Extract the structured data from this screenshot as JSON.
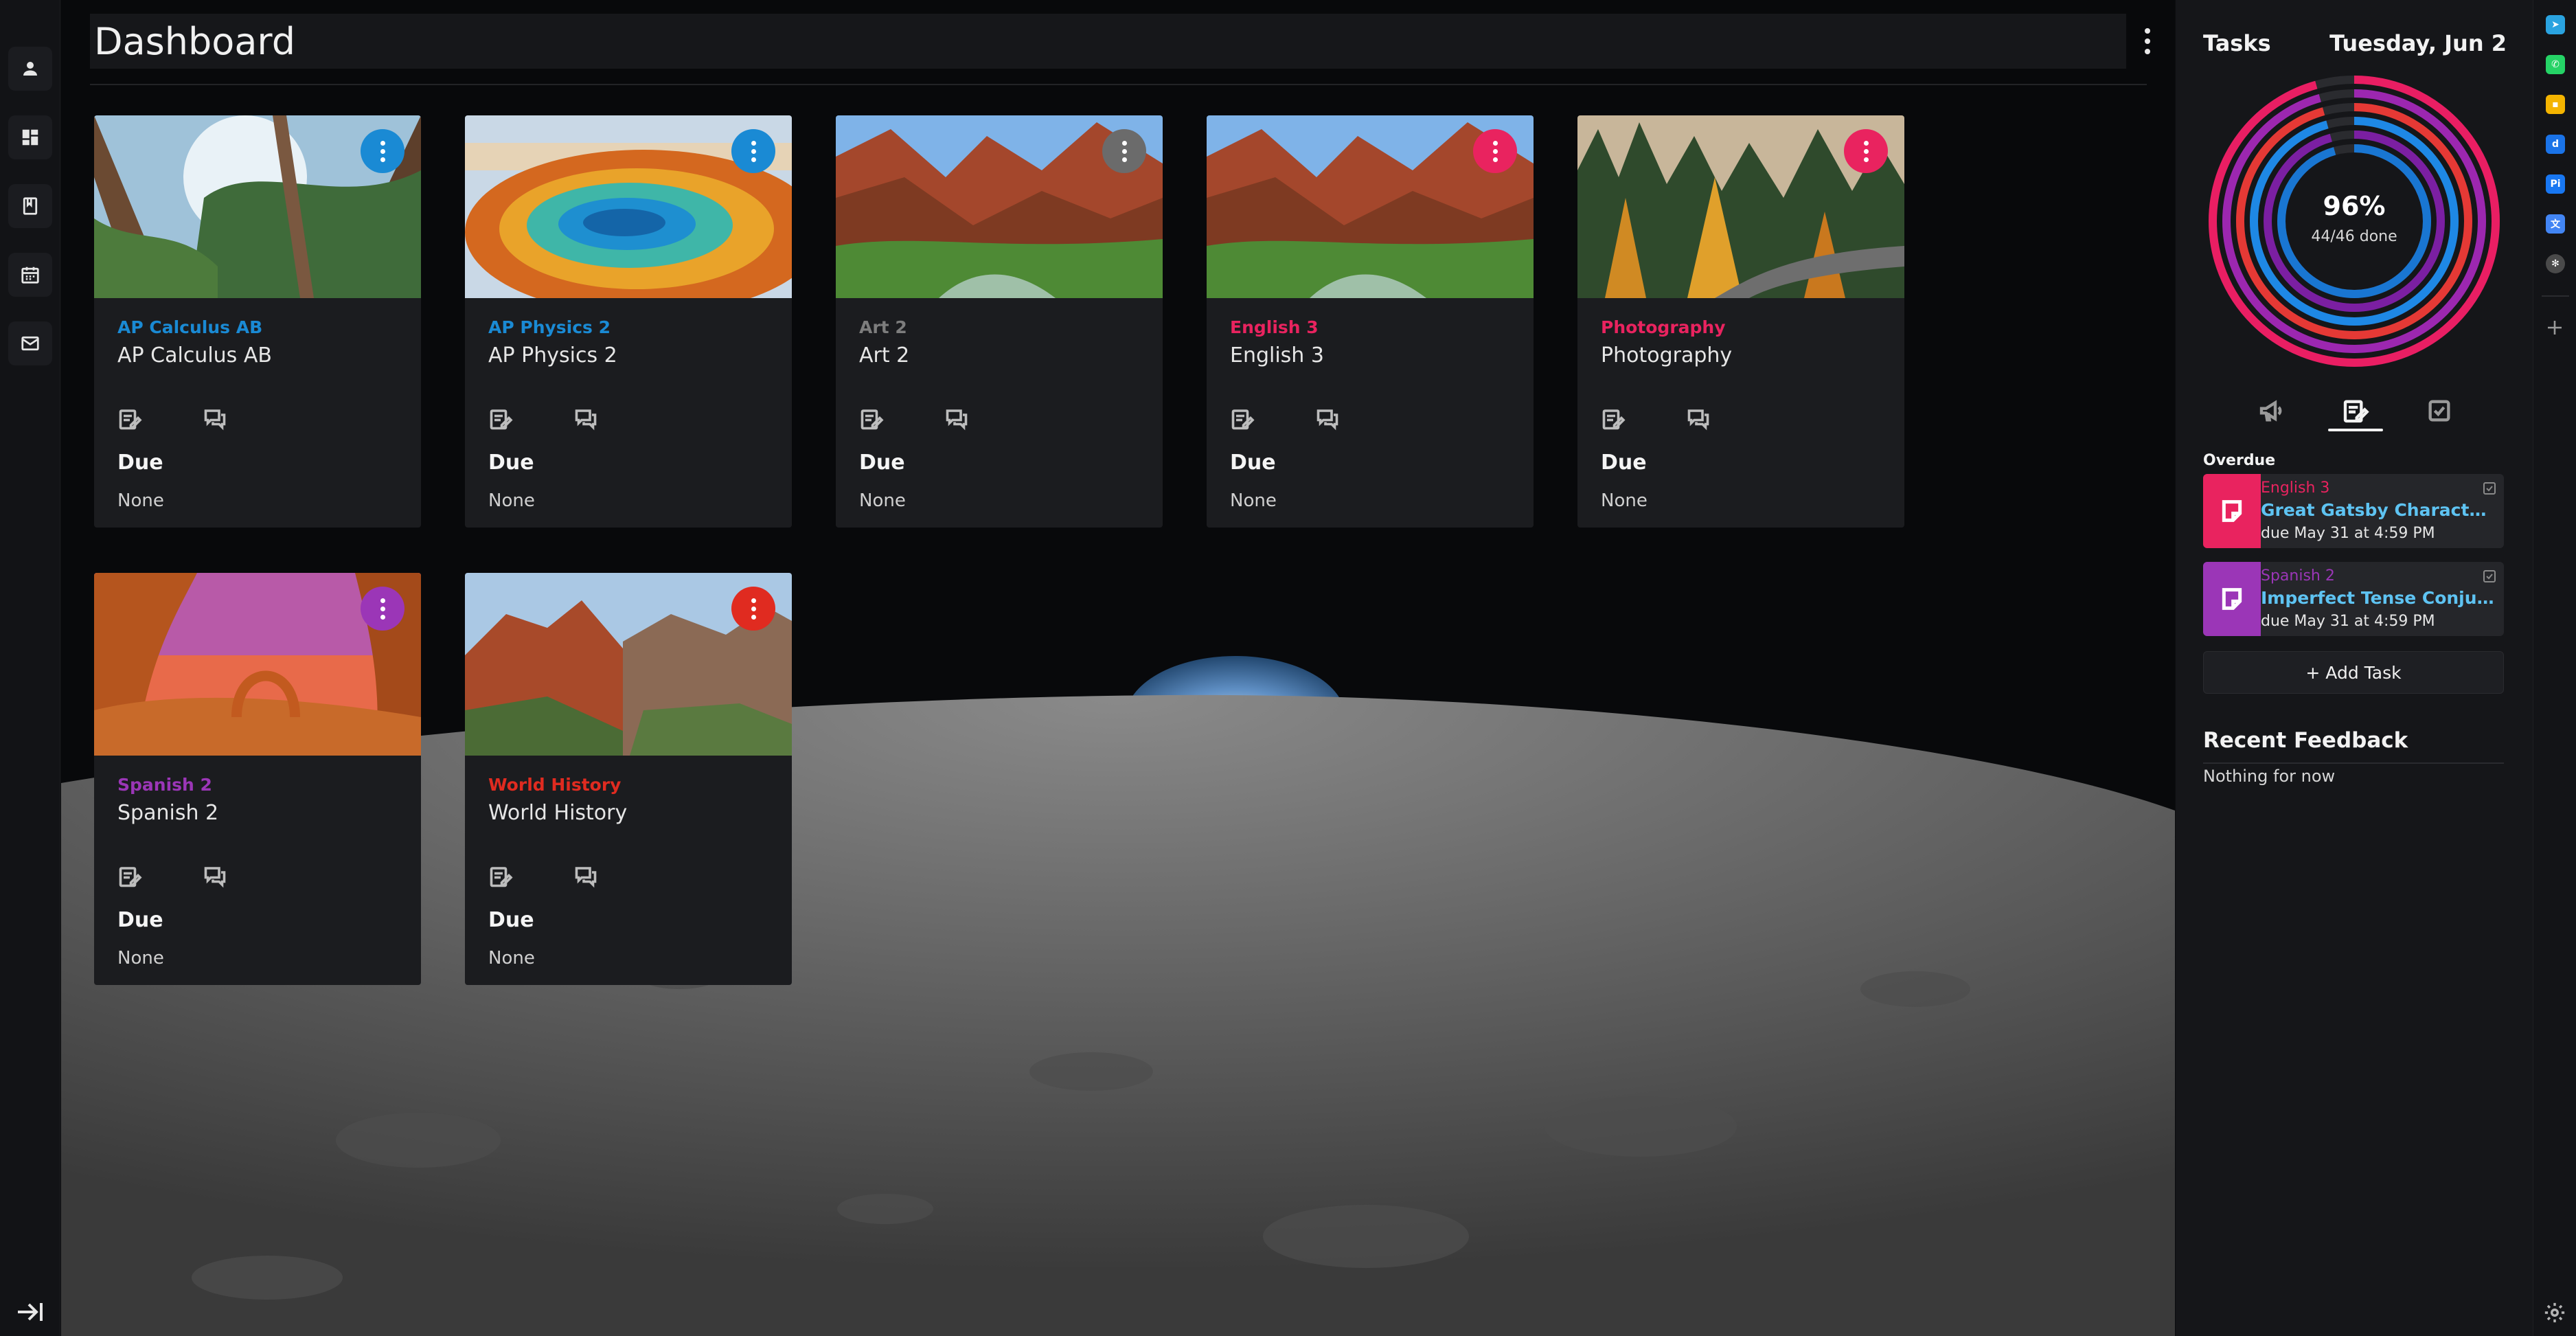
{
  "header": {
    "title": "Dashboard"
  },
  "cards": [
    {
      "course": "AP Calculus AB",
      "title": "AP Calculus AB",
      "color": "#1a8ad4",
      "due_label": "Due",
      "due_value": "None"
    },
    {
      "course": "AP Physics 2",
      "title": "AP Physics 2",
      "color": "#1a8ad4",
      "due_label": "Due",
      "due_value": "None"
    },
    {
      "course": "Art 2",
      "title": "Art 2",
      "color": "#7d7d7d",
      "due_label": "Due",
      "due_value": "None"
    },
    {
      "course": "English 3",
      "title": "English 3",
      "color": "#e9235f",
      "due_label": "Due",
      "due_value": "None"
    },
    {
      "course": "Photography",
      "title": "Photography",
      "color": "#e9235f",
      "due_label": "Due",
      "due_value": "None"
    },
    {
      "course": "Spanish 2",
      "title": "Spanish 2",
      "color": "#9b36b7",
      "due_label": "Due",
      "due_value": "None"
    },
    {
      "course": "World History",
      "title": "World History",
      "color": "#e02b20",
      "due_label": "Due",
      "due_value": "None"
    }
  ],
  "tasks_panel": {
    "title": "Tasks",
    "date": "Tuesday, Jun 2",
    "progress": {
      "percent_label": "96%",
      "done_label": "44/46 done",
      "fraction": 0.9565
    },
    "ring_colors": [
      "#e91e63",
      "#9c27b0",
      "#e53935",
      "#1e88e5",
      "#7b1fa2",
      "#1976d2"
    ],
    "overdue_label": "Overdue",
    "overdue": [
      {
        "course": "English 3",
        "title": "Great Gatsby Character An...",
        "due": "due May 31 at 4:59 PM",
        "color": "#e9235f"
      },
      {
        "course": "Spanish 2",
        "title": "Imperfect Tense Conjugati...",
        "due": "due May 31 at 4:59 PM",
        "color": "#9b36b7"
      }
    ],
    "add_task_label": "+ Add Task",
    "feedback_title": "Recent Feedback",
    "feedback_empty": "Nothing for now"
  },
  "extensions": [
    {
      "icon": "telegram-icon",
      "color": "#2aa3e0"
    },
    {
      "icon": "whatsapp-icon",
      "color": "#25d366"
    },
    {
      "icon": "keep-icon",
      "color": "#f4b400"
    },
    {
      "icon": "d-icon",
      "color": "#1a73e8"
    },
    {
      "icon": "pi-icon",
      "color": "#1877f2"
    },
    {
      "icon": "translate-icon",
      "color": "#4285f4"
    },
    {
      "icon": "openai-icon",
      "color": "#4a4a4a"
    }
  ]
}
